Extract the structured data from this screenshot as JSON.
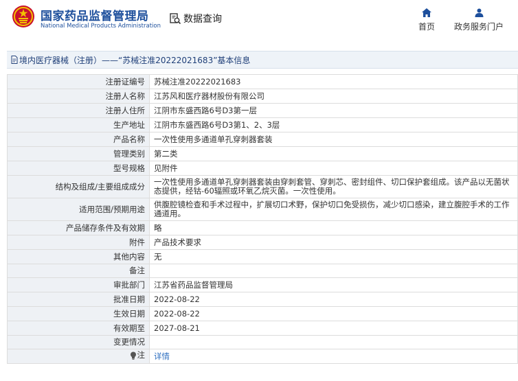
{
  "header": {
    "brand_cn": "国家药品监督管理局",
    "brand_en": "National Medical Products Administration",
    "search_label": "数据查询",
    "nav": [
      {
        "label": "首页",
        "icon": "home-icon"
      },
      {
        "label": "政务服务门户",
        "icon": "user-icon"
      }
    ]
  },
  "band": {
    "title": "境内医疗器械（注册）——“苏械注准20222021683”基本信息"
  },
  "rows": [
    {
      "key": "注册证编号",
      "value": "苏械注准20222021683"
    },
    {
      "key": "注册人名称",
      "value": "江苏风和医疗器材股份有限公司"
    },
    {
      "key": "注册人住所",
      "value": "江阴市东盛西路6号D3第一层"
    },
    {
      "key": "生产地址",
      "value": "江阴市东盛西路6号D3第1、2、3层"
    },
    {
      "key": "产品名称",
      "value": "一次性使用多通道单孔穿刺器套装"
    },
    {
      "key": "管理类别",
      "value": "第二类"
    },
    {
      "key": "型号规格",
      "value": "见附件"
    },
    {
      "key": "结构及组成/主要组成成分",
      "value": "一次性使用多通道单孔穿刺器套装由穿刺套管、穿刺芯、密封组件、切口保护套组成。该产品以无菌状态提供，经钴-60辐照或环氧乙烷灭菌。一次性使用。"
    },
    {
      "key": "适用范围/预期用途",
      "value": "供腹腔镜检查和手术过程中，扩展切口术野，保护切口免受损伤，减少切口感染，建立腹腔手术的工作通道用。"
    },
    {
      "key": "产品储存条件及有效期",
      "value": "略"
    },
    {
      "key": "附件",
      "value": "产品技术要求"
    },
    {
      "key": "其他内容",
      "value": "无"
    },
    {
      "key": "备注",
      "value": ""
    },
    {
      "key": "审批部门",
      "value": "江苏省药品监督管理局"
    },
    {
      "key": "批准日期",
      "value": "2022-08-22"
    },
    {
      "key": "生效日期",
      "value": "2022-08-22"
    },
    {
      "key": "有效期至",
      "value": "2027-08-21"
    },
    {
      "key": "变更情况",
      "value": ""
    },
    {
      "key": "注",
      "value": "详情"
    }
  ],
  "colors": {
    "brand_blue": "#1d4f9c",
    "band_bg": "#eef3f8",
    "key_bg": "#eef1f5",
    "link": "#2f6fc0"
  }
}
